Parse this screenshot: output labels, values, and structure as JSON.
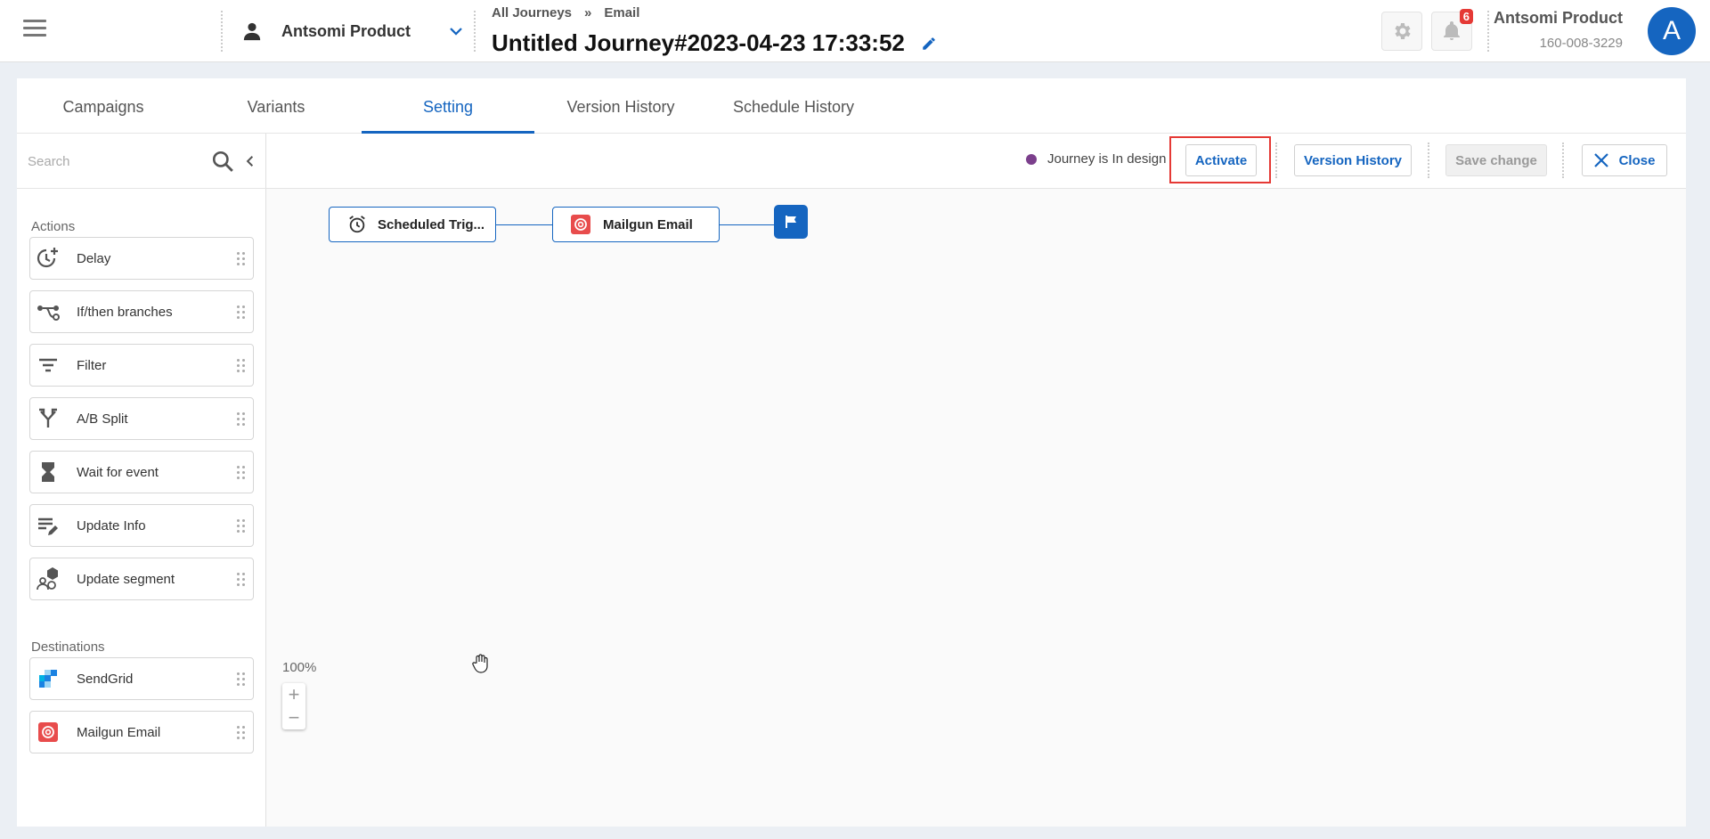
{
  "header": {
    "portal_name": "Antsomi Product",
    "breadcrumb": {
      "root": "All Journeys",
      "separator": "»",
      "current": "Email"
    },
    "journey_title": "Untitled Journey#2023-04-23 17:33:52",
    "notification_count": "6",
    "user": {
      "name": "Antsomi Product",
      "id": "160-008-3229",
      "avatar_letter": "A"
    }
  },
  "tabs": [
    {
      "label": "Campaigns"
    },
    {
      "label": "Variants"
    },
    {
      "label": "Setting"
    },
    {
      "label": "Version History"
    },
    {
      "label": "Schedule History"
    }
  ],
  "active_tab": "Setting",
  "sidebar": {
    "search_placeholder": "Search",
    "actions_label": "Actions",
    "actions": [
      {
        "label": "Delay",
        "icon": "delay-icon"
      },
      {
        "label": "If/then branches",
        "icon": "branch-icon"
      },
      {
        "label": "Filter",
        "icon": "filter-icon"
      },
      {
        "label": "A/B Split",
        "icon": "split-icon"
      },
      {
        "label": "Wait for event",
        "icon": "hourglass-icon"
      },
      {
        "label": "Update Info",
        "icon": "edit-list-icon"
      },
      {
        "label": "Update segment",
        "icon": "segment-icon"
      }
    ],
    "destinations_label": "Destinations",
    "destinations": [
      {
        "label": "SendGrid",
        "icon": "sendgrid-icon"
      },
      {
        "label": "Mailgun Email",
        "icon": "mailgun-icon"
      }
    ]
  },
  "toolbar": {
    "status_text": "Journey is In design",
    "status_color": "#7b3f8c",
    "activate_label": "Activate",
    "version_history_label": "Version History",
    "save_label": "Save change",
    "close_label": "Close"
  },
  "flow": {
    "trigger_label": "Scheduled Trig...",
    "email_label": "Mailgun Email"
  },
  "zoom": {
    "level": "100%",
    "plus": "+",
    "minus": "−"
  },
  "colors": {
    "accent": "#1565c0",
    "highlight": "#e53935",
    "mailgun": "#e84c4c"
  }
}
